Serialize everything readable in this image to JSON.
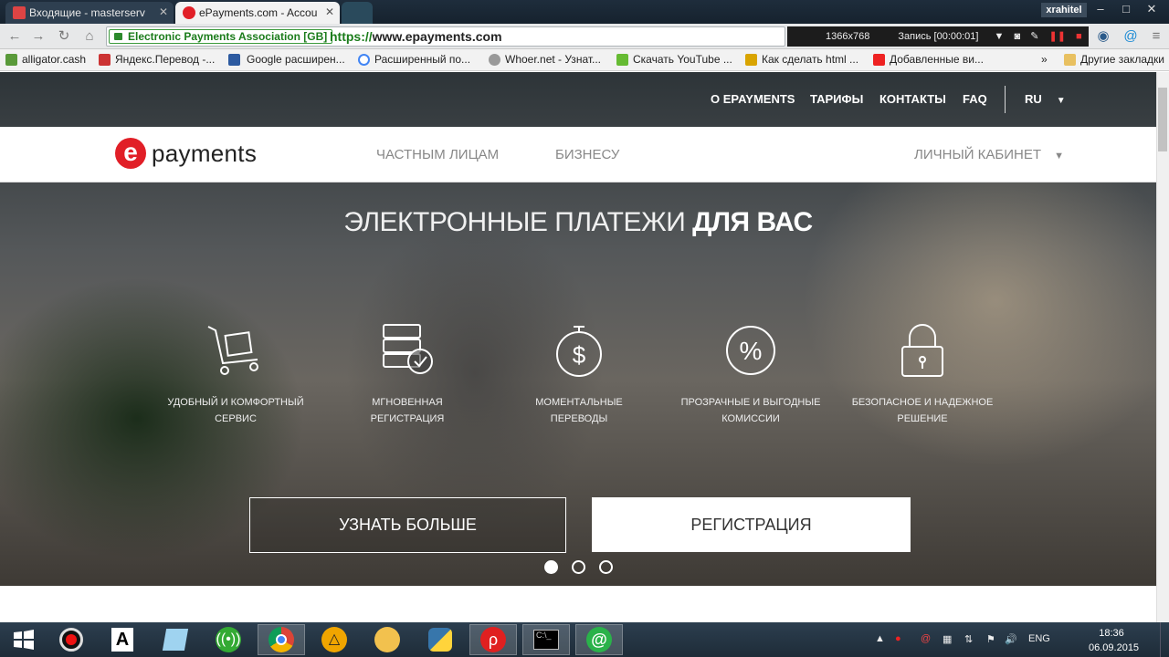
{
  "browser": {
    "tabs": [
      {
        "title": "Входящие - masterserv"
      },
      {
        "title": "ePayments.com - Accou"
      },
      {
        "title": ""
      }
    ],
    "user": "xrahitel",
    "ev_label": "Electronic Payments Association [GB]",
    "url_scheme": "https://",
    "url_host": "www.epayments.com",
    "recorder": {
      "resolution": "1366x768",
      "status": "Запись [00:00:01]"
    },
    "bookmarks": [
      "alligator.cash",
      "Яндекс.Перевод -...",
      "Google расширен...",
      "Расширенный по...",
      "Whoer.net - Узнат...",
      "Скачать YouTube ...",
      "Как сделать html ...",
      "Добавленные ви..."
    ],
    "bookmarks_more": "»",
    "other_bookmarks": "Другие закладки"
  },
  "site": {
    "top_nav": [
      "О EPAYMENTS",
      "ТАРИФЫ",
      "КОНТАКТЫ",
      "FAQ"
    ],
    "lang": "RU",
    "logo_text": "payments",
    "logo_mark": "e",
    "main_nav": [
      "ЧАСТНЫМ ЛИЦАМ",
      "БИЗНЕСУ"
    ],
    "cabinet": "ЛИЧНЫЙ КАБИНЕТ",
    "headline_light": "ЭЛЕКТРОННЫЕ ПЛАТЕЖИ ",
    "headline_bold": "ДЛЯ ВАС",
    "features": [
      {
        "icon": "cart-icon",
        "line1": "УДОБНЫЙ И КОМФОРТНЫЙ",
        "line2": "СЕРВИС"
      },
      {
        "icon": "server-clock-icon",
        "line1": "МГНОВЕННАЯ РЕГИСТРАЦИЯ",
        "line2": ""
      },
      {
        "icon": "stopwatch-dollar-icon",
        "line1": "МОМЕНТАЛЬНЫЕ ПЕРЕВОДЫ",
        "line2": ""
      },
      {
        "icon": "percent-icon",
        "line1": "ПРОЗРАЧНЫЕ И ВЫГОДНЫЕ",
        "line2": "КОМИССИИ"
      },
      {
        "icon": "lock-icon",
        "line1": "БЕЗОПАСНОЕ И НАДЕЖНОЕ",
        "line2": "РЕШЕНИЕ"
      }
    ],
    "btn_more": "УЗНАТЬ БОЛЬШЕ",
    "btn_register": "РЕГИСТРАЦИЯ",
    "slider_active": 1
  },
  "taskbar": {
    "lang": "ENG",
    "time": "18:36",
    "date": "06.09.2015"
  },
  "colors": {
    "brand": "#e11f27",
    "ev_green": "#1b7c1b"
  }
}
